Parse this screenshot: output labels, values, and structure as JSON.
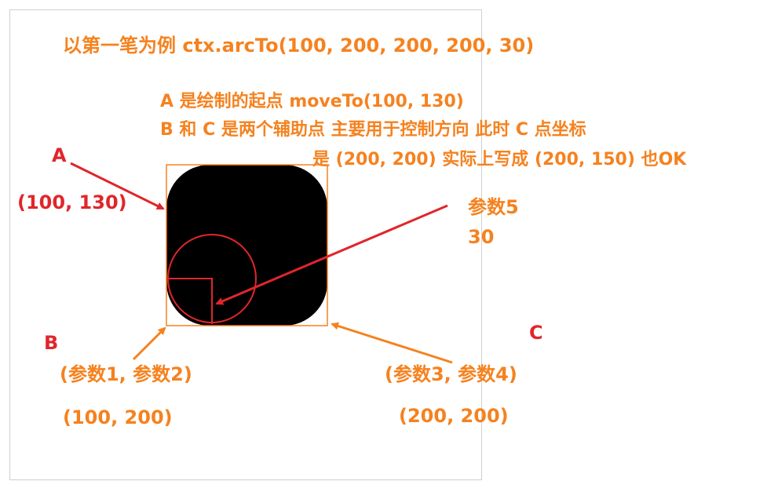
{
  "title": "以第一笔为例 ctx.arcTo(100, 200, 200, 200, 30)",
  "notes": [
    "A 是绘制的起点 moveTo(100, 130)",
    "B 和 C 是两个辅助点 主要用于控制方向 此时 C 点坐标",
    "是 (200, 200) 实际上写成 (200, 150) 也OK"
  ],
  "point_a": {
    "name": "A",
    "coords": "(100, 130)"
  },
  "point_b": {
    "name": "B",
    "params": "(参数1, 参数2)",
    "coords": "(100, 200)"
  },
  "point_c": {
    "name": "C",
    "params": "(参数3, 参数4)",
    "coords": "(200, 200)"
  },
  "radius_param": {
    "label": "参数5",
    "value": "30"
  },
  "colors": {
    "orange": "#f5821f",
    "red": "#e0262b",
    "shape": "#000000",
    "frame": "#cfcfcf"
  }
}
